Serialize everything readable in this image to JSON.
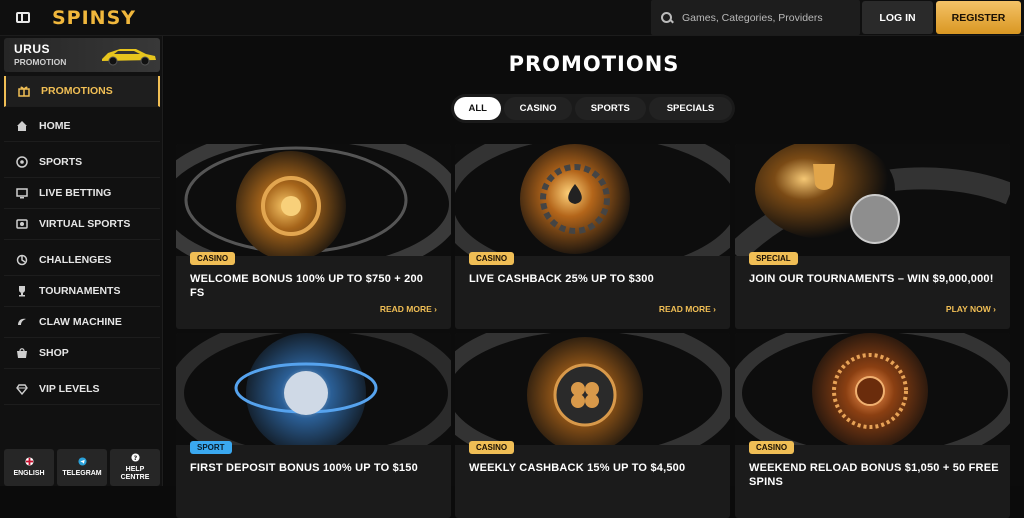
{
  "header": {
    "logo": "SPINSY",
    "search_placeholder": "Games, Categories, Providers",
    "login_label": "LOG IN",
    "register_label": "REGISTER",
    "accent_color": "#f0b73c"
  },
  "sidebar": {
    "banner": {
      "title": "URUS",
      "subtitle": "PROMOTION"
    },
    "items": [
      {
        "label": "PROMOTIONS",
        "icon": "gift-icon",
        "active": true
      },
      {
        "label": "HOME",
        "icon": "home-icon"
      },
      {
        "label": "SPORTS",
        "icon": "sports-icon"
      },
      {
        "label": "LIVE BETTING",
        "icon": "live-betting-icon"
      },
      {
        "label": "VIRTUAL SPORTS",
        "icon": "virtual-sports-icon"
      },
      {
        "label": "CHALLENGES",
        "icon": "challenges-icon"
      },
      {
        "label": "TOURNAMENTS",
        "icon": "trophy-icon"
      },
      {
        "label": "CLAW MACHINE",
        "icon": "claw-icon"
      },
      {
        "label": "SHOP",
        "icon": "shop-icon"
      },
      {
        "label": "VIP LEVELS",
        "icon": "diamond-icon"
      }
    ],
    "bottom": [
      {
        "label": "ENGLISH",
        "icon": "flag-icon"
      },
      {
        "label": "TELEGRAM",
        "icon": "telegram-icon"
      },
      {
        "label": "HELP CENTRE",
        "icon": "help-icon"
      }
    ]
  },
  "main": {
    "title": "PROMOTIONS",
    "tabs": [
      "ALL",
      "CASINO",
      "SPORTS",
      "SPECIALS"
    ],
    "active_tab": "ALL",
    "cards": [
      {
        "badge": "CASINO",
        "title": "WELCOME BONUS 100% UP TO $750 + 200 FS",
        "cta": "READ MORE",
        "kind": "casino"
      },
      {
        "badge": "CASINO",
        "title": "LIVE CASHBACK 25% UP TO $300",
        "cta": "READ MORE",
        "kind": "casino"
      },
      {
        "badge": "SPECIAL",
        "title": "JOIN OUR TOURNAMENTS – WIN $9,000,000!",
        "cta": "PLAY NOW",
        "kind": "special"
      },
      {
        "badge": "SPORT",
        "title": "FIRST DEPOSIT BONUS 100% UP TO $150",
        "cta": "",
        "kind": "sport"
      },
      {
        "badge": "CASINO",
        "title": "WEEKLY CASHBACK 15% UP TO $4,500",
        "cta": "",
        "kind": "casino"
      },
      {
        "badge": "CASINO",
        "title": "WEEKEND RELOAD BONUS $1,050 + 50 FREE SPINS",
        "cta": "",
        "kind": "casino"
      }
    ]
  }
}
